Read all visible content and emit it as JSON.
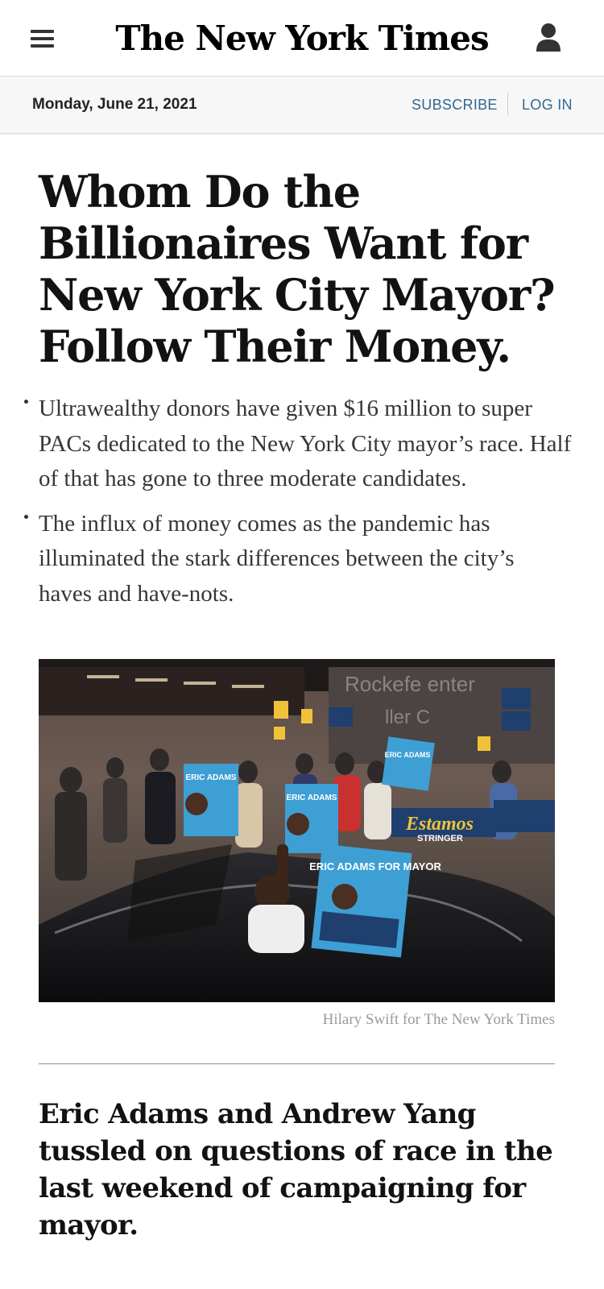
{
  "header": {
    "masthead": "The New York Times",
    "menu_icon": "hamburger-menu-icon",
    "account_icon": "user-icon"
  },
  "datebar": {
    "date": "Monday, June 21, 2021",
    "subscribe": "SUBSCRIBE",
    "login": "LOG IN"
  },
  "article": {
    "headline": "Whom Do the Billionaires Want for New York City Mayor? Follow Their Money.",
    "summary": [
      "Ultrawealthy donors have given $16 million to super PACs dedicated to the New York City mayor’s race. Half of that has gone to three moderate candidates.",
      "The influx of money comes as the pandemic has illuminated the stark differences between the city’s haves and have-nots."
    ],
    "photo": {
      "signs": [
        "ERIC ADAMS",
        "ERIC ADAMS",
        "ERIC ADAMS FOR MAYOR",
        "ERIC ADAMS",
        "STRINGER"
      ],
      "credit": "Hilary Swift for The New York Times"
    }
  },
  "next_story": {
    "headline": "Eric Adams and Andrew Yang tussled on questions of race in the last weekend of campaigning for mayor."
  },
  "colors": {
    "link": "#326891",
    "text": "#121212",
    "summary_text": "#363636",
    "credit": "#9a9a9a"
  }
}
